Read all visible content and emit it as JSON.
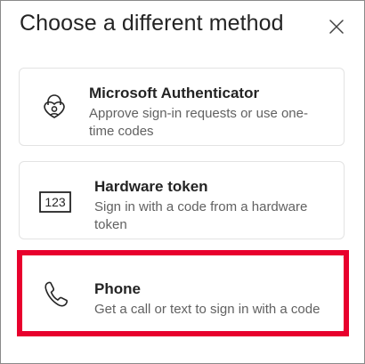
{
  "dialog": {
    "title": "Choose a different method"
  },
  "methods": [
    {
      "icon": "authenticator-lock-icon",
      "title": "Microsoft Authenticator",
      "description": "Approve sign-in requests or use one-time codes"
    },
    {
      "icon": "hardware-token-123-icon",
      "icon_text": "123",
      "title": "Hardware token",
      "description": "Sign in with a code from a hardware token"
    },
    {
      "icon": "phone-icon",
      "title": "Phone",
      "description": "Get a call or text to sign in with a code"
    }
  ],
  "colors": {
    "highlight": "#e8002d",
    "title_text": "#242424",
    "secondary_text": "#616161",
    "card_border": "#e3e3e3"
  }
}
